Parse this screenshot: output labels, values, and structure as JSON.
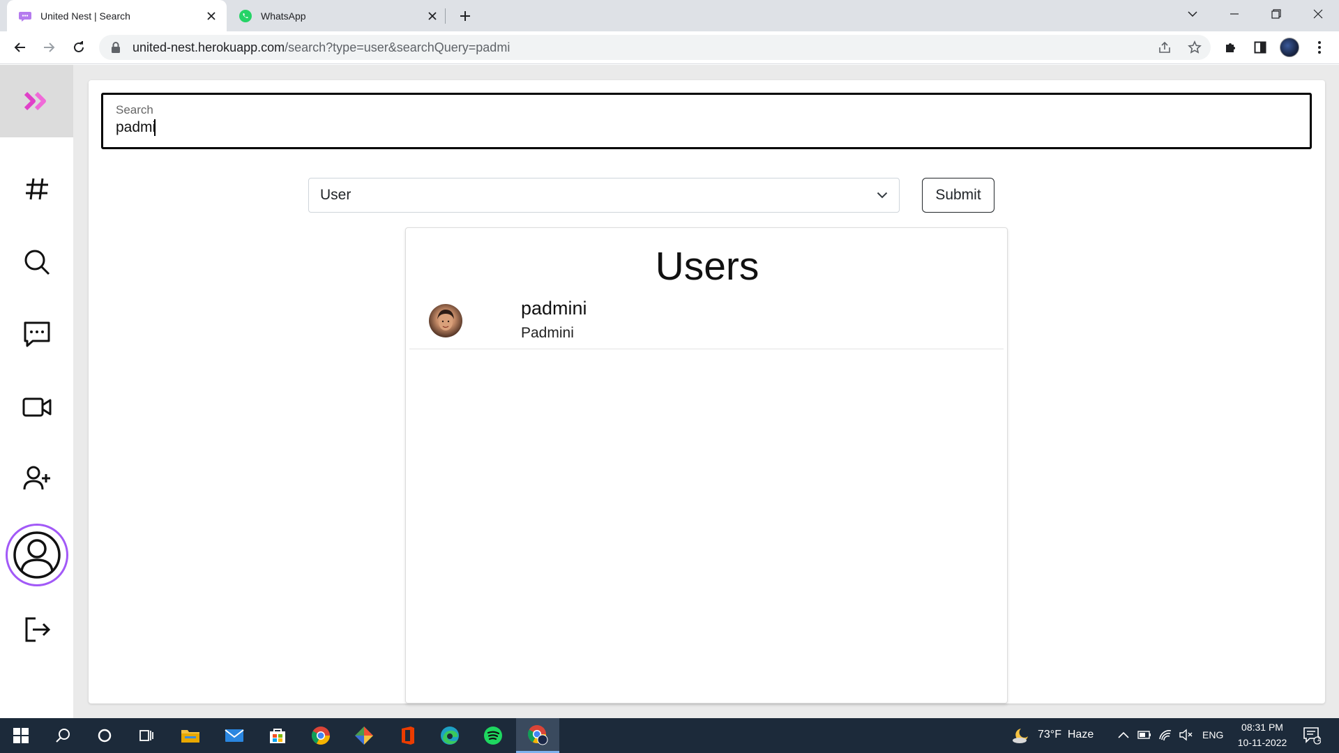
{
  "browser": {
    "tabs": [
      {
        "title": "United Nest | Search",
        "active": true
      },
      {
        "title": "WhatsApp",
        "active": false
      }
    ],
    "url": {
      "host": "united-nest.herokuapp.com",
      "path": "/search?type=user&searchQuery=padmi"
    }
  },
  "sidebar": {
    "items": [
      "logo-chevrons-icon",
      "hash-icon",
      "search-icon",
      "chat-icon",
      "video-icon",
      "add-user-icon",
      "profile-icon",
      "logout-icon"
    ]
  },
  "search": {
    "label": "Search",
    "value": "padmi"
  },
  "type_select": {
    "selected": "User"
  },
  "submit": {
    "label": "Submit"
  },
  "results": {
    "heading": "Users",
    "users": [
      {
        "username": "padmini",
        "display_name": "Padmini"
      }
    ]
  },
  "taskbar": {
    "weather": "73°F  Haze",
    "lang": "ENG",
    "time": "08:31 PM",
    "date": "10-11-2022",
    "notifications": "1"
  },
  "colors": {
    "accent_purple": "#a259f7",
    "logo_pink": "#e040c8",
    "taskbar": "#1c2a3a"
  }
}
